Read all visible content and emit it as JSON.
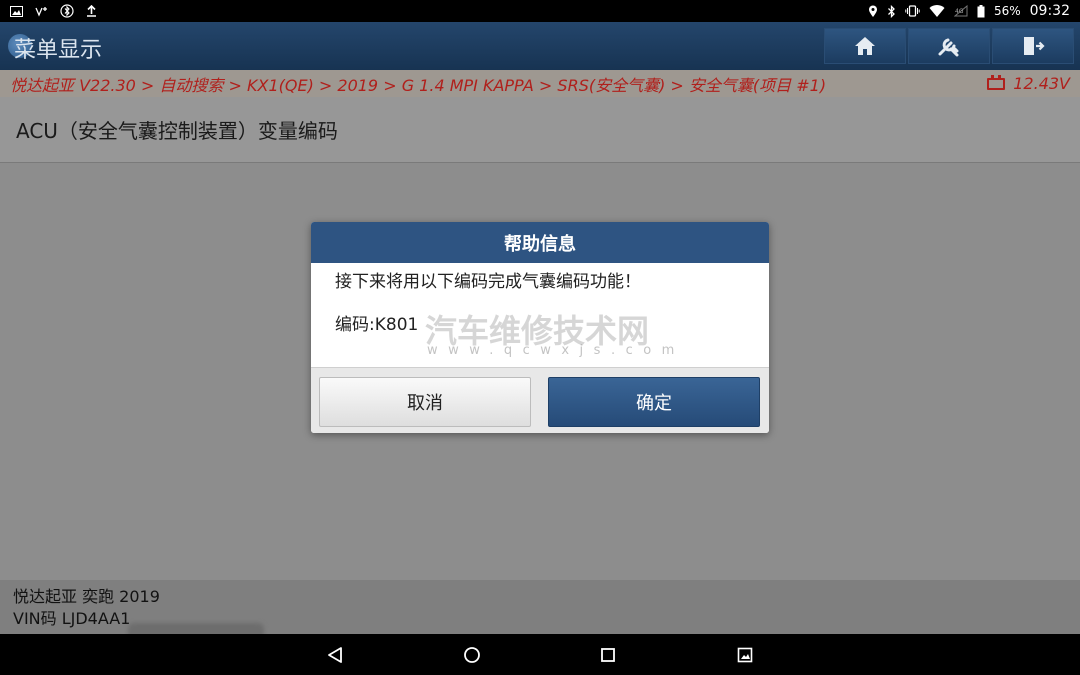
{
  "status_bar": {
    "battery_percent": "56%",
    "time": "09:32"
  },
  "app": {
    "title": "菜单显示"
  },
  "breadcrumb": {
    "path": "悦达起亚 V22.30 > 自动搜索 > KX1(QE) > 2019 > G 1.4 MPI KAPPA > SRS(安全气囊) > 安全气囊(项目 #1)",
    "voltage": "12.43V"
  },
  "page": {
    "title": "ACU（安全气囊控制装置）变量编码"
  },
  "dialog": {
    "title": "帮助信息",
    "message": "接下来将用以下编码完成气囊编码功能！",
    "code_label": "编码:K801",
    "cancel_label": "取消",
    "ok_label": "确定"
  },
  "watermark": {
    "cn": "汽车维修技术网",
    "en": "www.qcwxjs.com"
  },
  "footer": {
    "vehicle": "悦达起亚 奕跑 2019",
    "vin": "VIN码 LJD4AA1"
  },
  "colors": {
    "header_blue": "#1c3a5c",
    "dialog_blue": "#2e5482",
    "breadcrumb_red": "#b0201c"
  }
}
